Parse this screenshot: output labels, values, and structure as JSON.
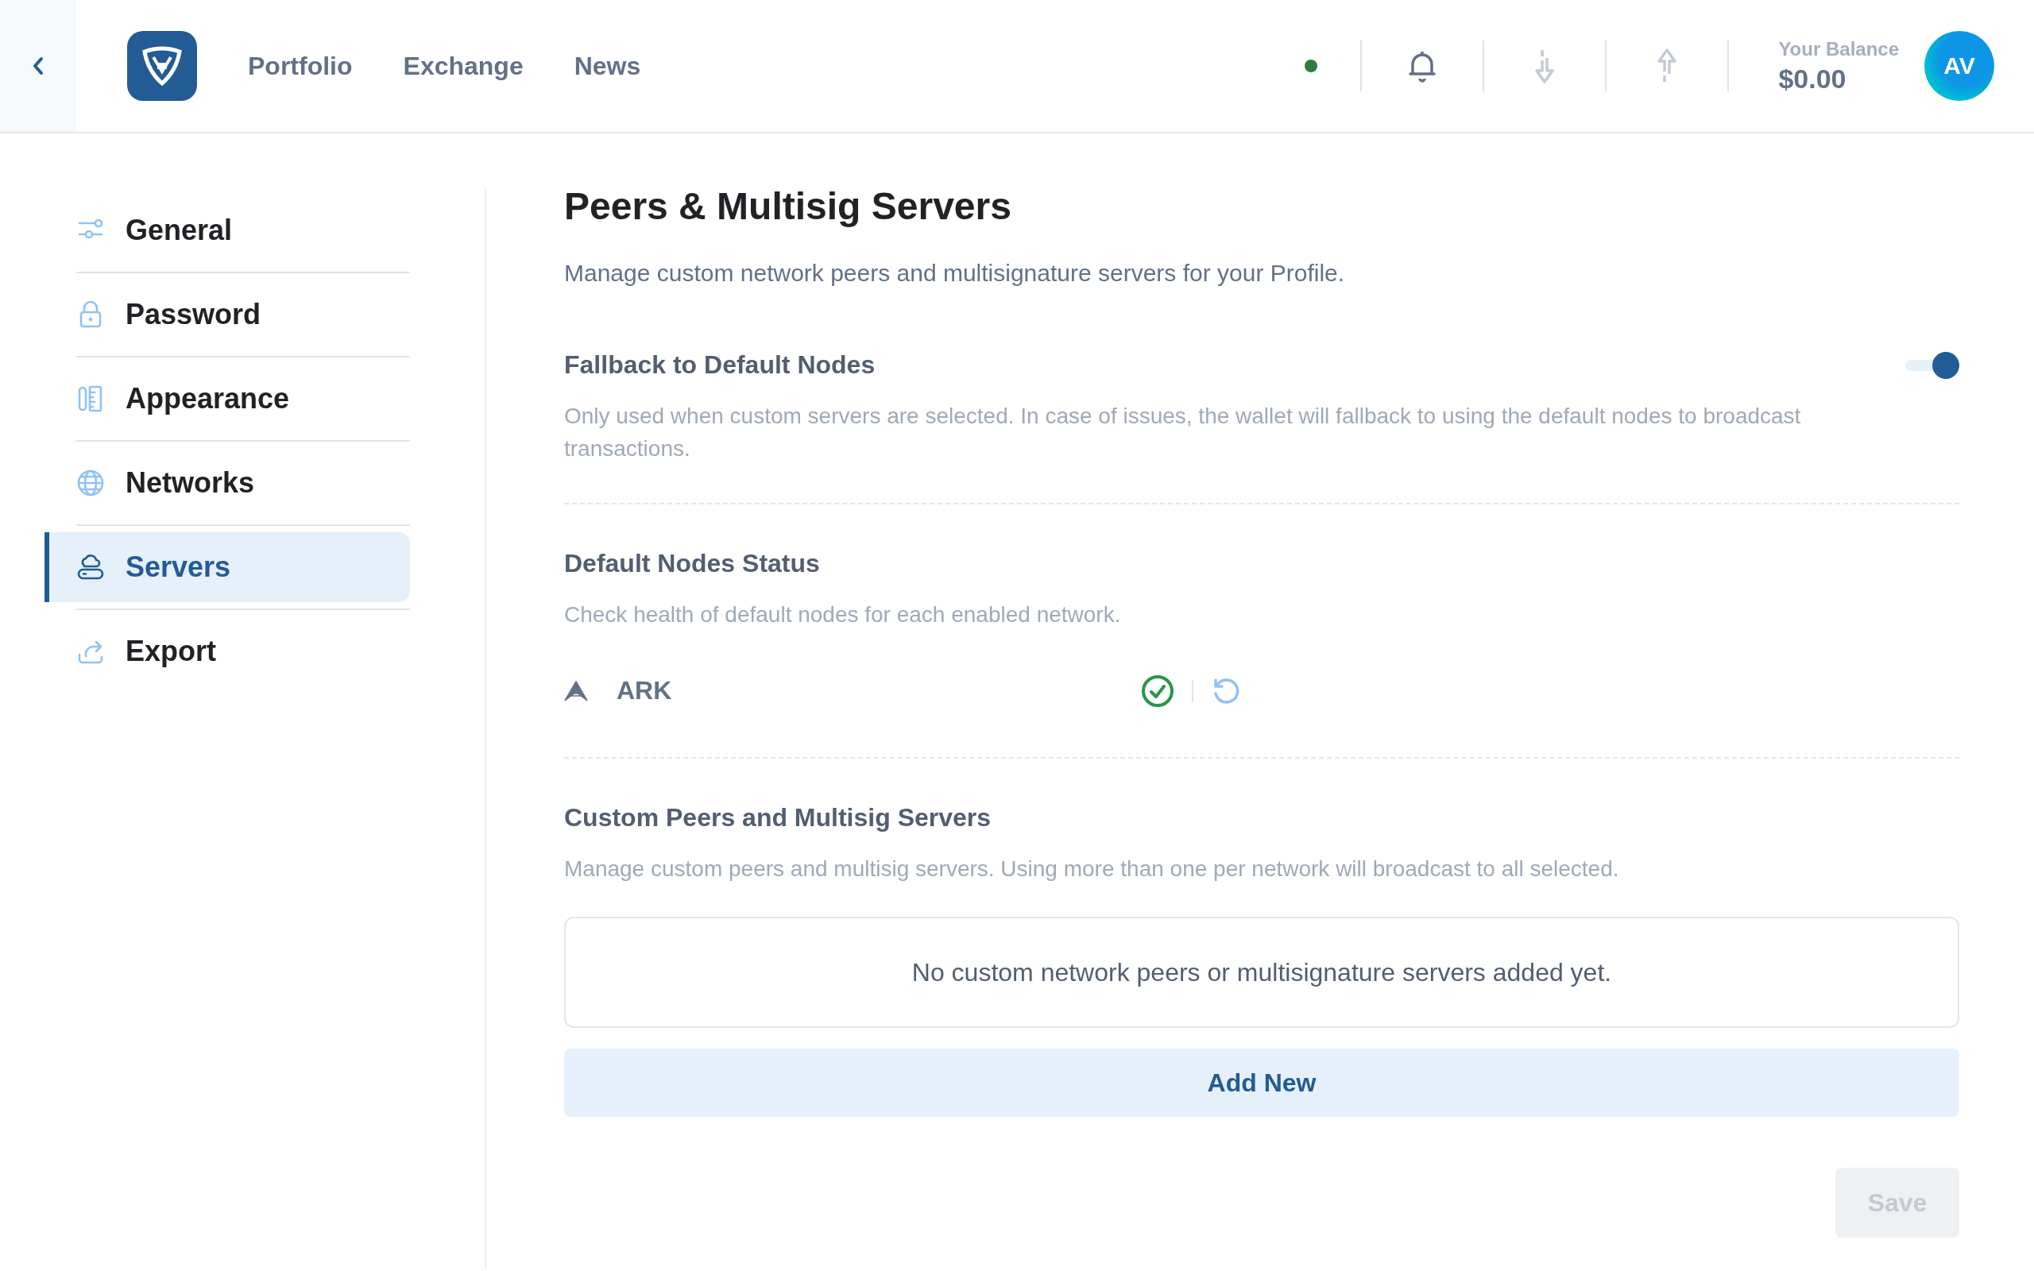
{
  "header": {
    "nav": [
      {
        "label": "Portfolio"
      },
      {
        "label": "Exchange"
      },
      {
        "label": "News"
      }
    ],
    "connection_online": true,
    "balance_label": "Your Balance",
    "balance": "$0.00",
    "avatar_initials": "AV"
  },
  "sidebar": {
    "items": [
      {
        "label": "General",
        "selected": false
      },
      {
        "label": "Password",
        "selected": false
      },
      {
        "label": "Appearance",
        "selected": false
      },
      {
        "label": "Networks",
        "selected": false
      },
      {
        "label": "Servers",
        "selected": true
      },
      {
        "label": "Export",
        "selected": false
      }
    ]
  },
  "page": {
    "title": "Peers & Multisig Servers",
    "description": "Manage custom network peers and multisignature servers for your Profile.",
    "fallback": {
      "title": "Fallback to Default Nodes",
      "description": "Only used when custom servers are selected. In case of issues, the wallet will fallback to using the default nodes to broadcast transactions.",
      "on": true
    },
    "default_nodes": {
      "title": "Default Nodes Status",
      "description": "Check health of default nodes for each enabled network.",
      "networks": [
        {
          "name": "ARK",
          "healthy": true
        }
      ]
    },
    "custom": {
      "title": "Custom Peers and Multisig Servers",
      "description": "Manage custom peers and multisig servers. Using more than one per network will broadcast to all selected.",
      "empty_message": "No custom network peers or multisignature servers added yet.",
      "add_button": "Add New"
    },
    "save_button": {
      "label": "Save",
      "disabled": true
    }
  }
}
